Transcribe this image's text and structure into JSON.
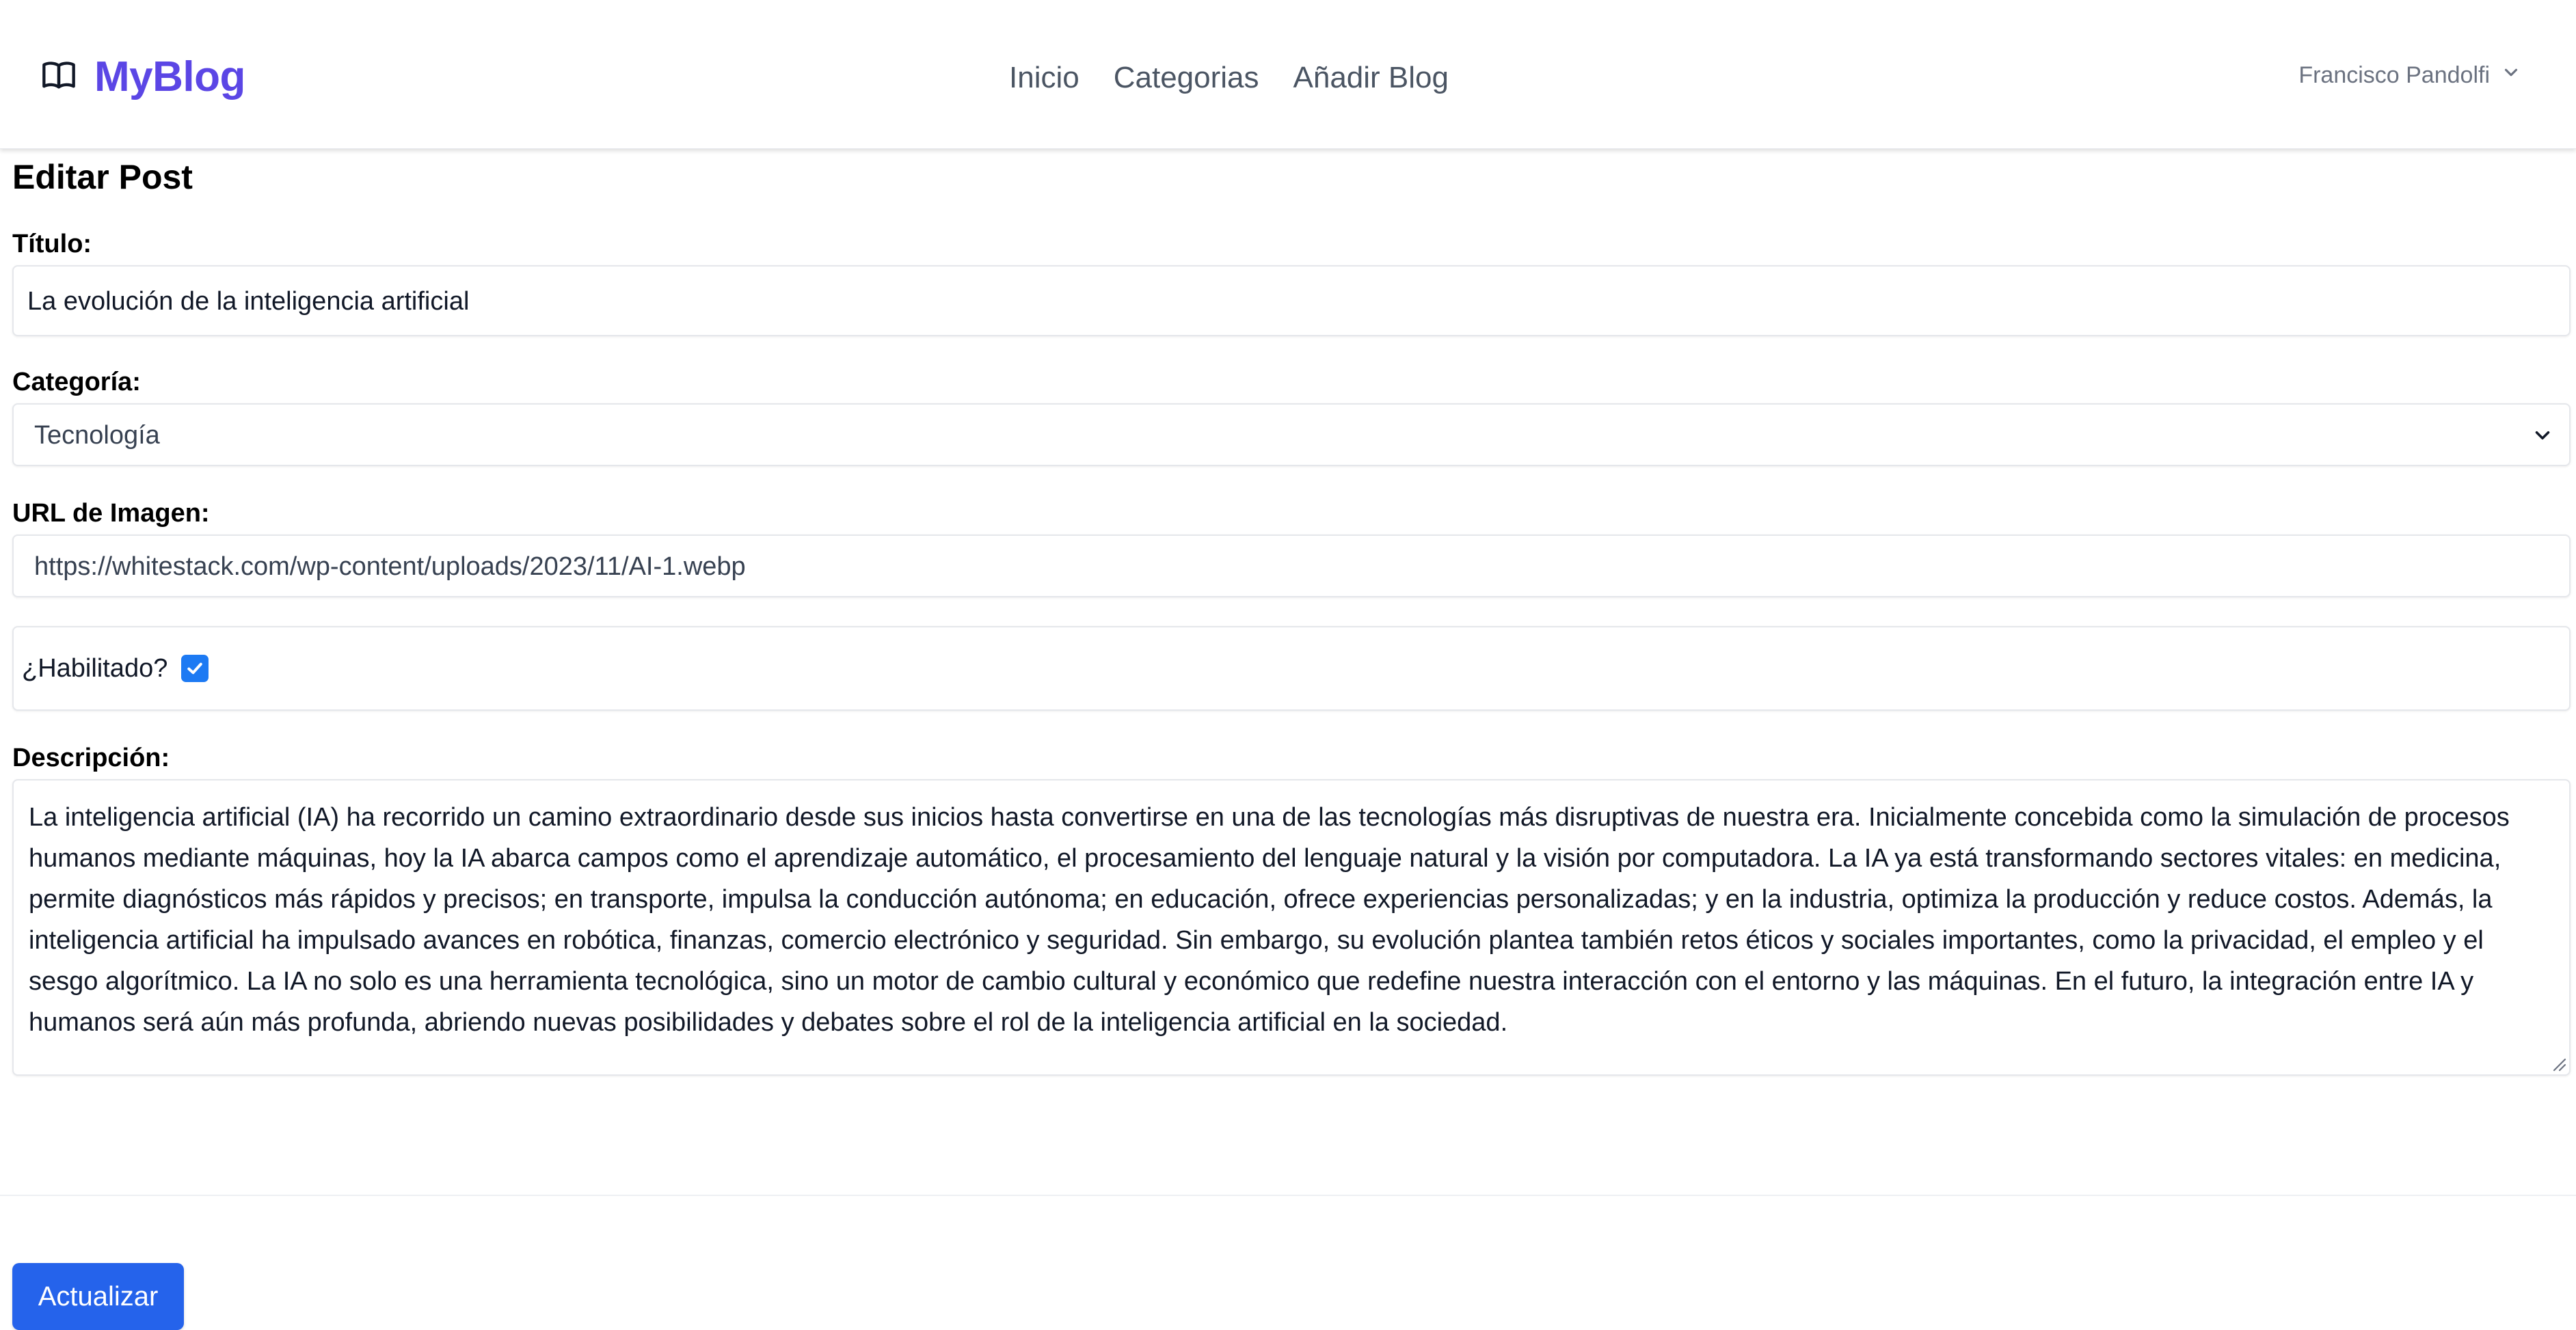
{
  "nav": {
    "brand": "MyBlog",
    "brand_icon": "book-open-icon",
    "links": [
      "Inicio",
      "Categorias",
      "Añadir Blog"
    ],
    "user_name": "Francisco Pandolfi"
  },
  "form": {
    "heading": "Editar Post",
    "title_label": "Título:",
    "title_value": "La evolución de la inteligencia artificial",
    "category_label": "Categoría:",
    "category_value": "Tecnología",
    "image_url_label": "URL de Imagen:",
    "image_url_value": "https://whitestack.com/wp-content/uploads/2023/11/AI-1.webp",
    "enabled_label": "¿Habilitado?",
    "enabled": true,
    "description_label": "Descripción:",
    "description_value": "La inteligencia artificial (IA) ha recorrido un camino extraordinario desde sus inicios hasta convertirse en una de las tecnologías más disruptivas de nuestra era. Inicialmente concebida como la simulación de procesos humanos mediante máquinas, hoy la IA abarca campos como el aprendizaje automático, el procesamiento del lenguaje natural y la visión por computadora. La IA ya está transformando sectores vitales: en medicina, permite diagnósticos más rápidos y precisos; en transporte, impulsa la conducción autónoma; en educación, ofrece experiencias personalizadas; y en la industria, optimiza la producción y reduce costos. Además, la inteligencia artificial ha impulsado avances en robótica, finanzas, comercio electrónico y seguridad. Sin embargo, su evolución plantea también retos éticos y sociales importantes, como la privacidad, el empleo y el sesgo algorítmico. La IA no solo es una herramienta tecnológica, sino un motor de cambio cultural y económico que redefine nuestra interacción con el entorno y las máquinas. En el futuro, la integración entre IA y humanos será aún más profunda, abriendo nuevas posibilidades y debates sobre el rol de la inteligencia artificial en la sociedad.",
    "submit_label": "Actualizar"
  },
  "colors": {
    "brand": "#5b46e5",
    "primary_button": "#2563eb",
    "checkbox": "#1d7af3"
  }
}
